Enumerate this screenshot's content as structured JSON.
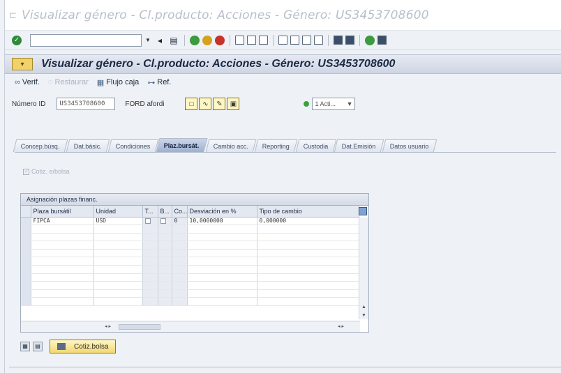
{
  "window": {
    "title": "Visualizar género - Cl.producto: Acciones - Género: US3453708600"
  },
  "screen": {
    "title": "Visualizar género - Cl.producto: Acciones - Género: US3453708600"
  },
  "app_toolbar": {
    "verif": "Verif.",
    "restaurar": "Restaurar",
    "flujo_caja": "Flujo caja",
    "ref": "Ref."
  },
  "header": {
    "numero_id_label": "Número ID",
    "numero_id_value": "US3453708600",
    "name": "FORD afordi",
    "status_select": "1 Acti..."
  },
  "tabs": [
    {
      "label": "Concep.búsq."
    },
    {
      "label": "Dat.básic."
    },
    {
      "label": "Condiciones"
    },
    {
      "label": "Plaz.bursát."
    },
    {
      "label": "Cambio acc."
    },
    {
      "label": "Reporting"
    },
    {
      "label": "Custodia"
    },
    {
      "label": "Dat.Emisión"
    },
    {
      "label": "Datos usuario"
    }
  ],
  "plaz_tab": {
    "cotiz_checkbox_label": "Cotiz. e/bolsa",
    "table_title": "Asignación plazas financ.",
    "columns": [
      "Plaza bursátil",
      "Unidad",
      "T...",
      "B...",
      "Co...",
      "Desviación en %",
      "Tipo de cambio"
    ],
    "rows": [
      {
        "plaza": "FIPCA",
        "unidad": "USD",
        "co": "0",
        "desviacion": "10,0000000",
        "tipo_cambio": "0,000000"
      }
    ],
    "cotiz_bolsa_button": "Cotiz.bolsa"
  },
  "colors": {
    "screen_title_bg": "#cfd5e3",
    "active_tab": "#9eb0d0",
    "button_yellow": "#f1d872"
  }
}
